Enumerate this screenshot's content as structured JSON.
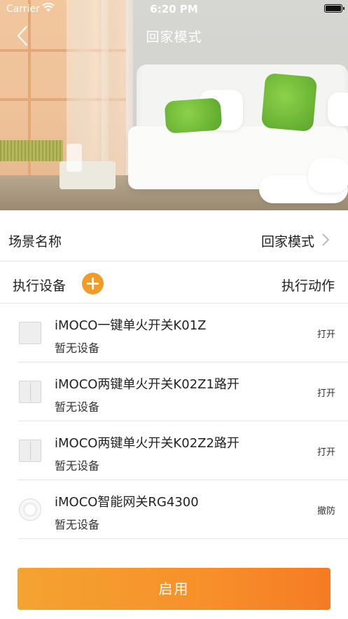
{
  "status_bar": {
    "carrier": "Carrier",
    "time": "6:20 PM"
  },
  "nav": {
    "title": "回家模式",
    "back_icon": "chevron-left-icon"
  },
  "scene": {
    "label": "场景名称",
    "value": "回家模式"
  },
  "exec": {
    "devices_label": "执行设备",
    "actions_label": "执行动作",
    "add_color": "#f29b28"
  },
  "devices": [
    {
      "name": "iMOCO一键单火开关K01Z",
      "status": "暂无设备",
      "action": "打开",
      "icon": "switch-1gang-icon"
    },
    {
      "name": "iMOCO两键单火开关K02Z1路开",
      "status": "暂无设备",
      "action": "打开",
      "icon": "switch-2gang-icon"
    },
    {
      "name": "iMOCO两键单火开关K02Z2路开",
      "status": "暂无设备",
      "action": "打开",
      "icon": "switch-2gang-icon"
    },
    {
      "name": "iMOCO智能网关RG4300",
      "status": "暂无设备",
      "action": "撤防",
      "icon": "gateway-icon"
    }
  ],
  "enable_button": {
    "label": "启用",
    "color": "#f7902a"
  }
}
